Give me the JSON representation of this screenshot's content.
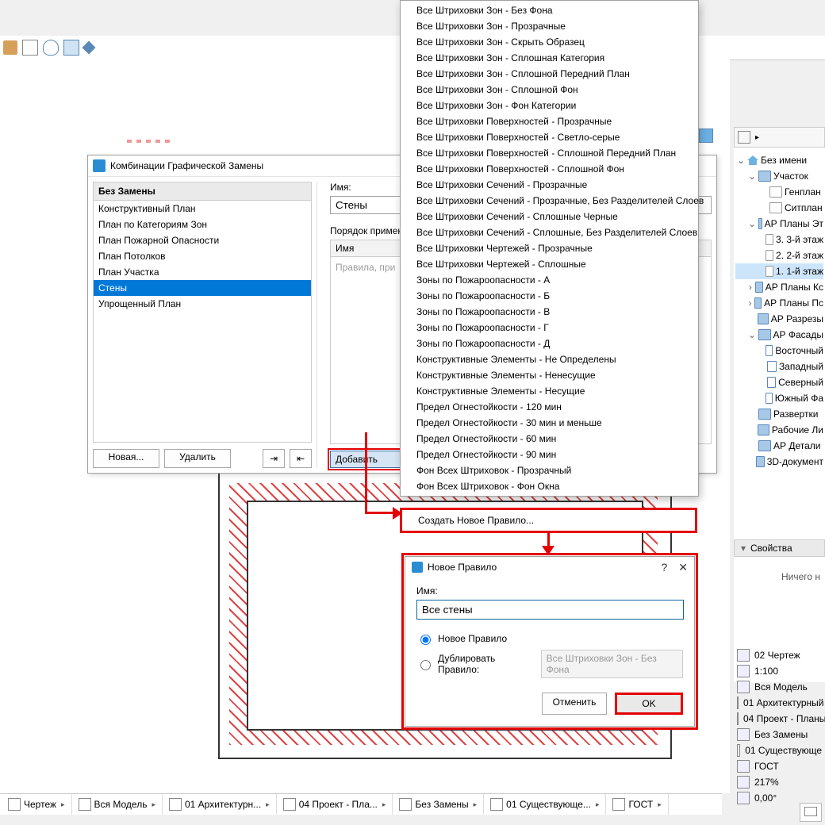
{
  "toolbar": {
    "icons": [
      "layers",
      "note",
      "cloud",
      "book",
      "diamond"
    ]
  },
  "dialog1": {
    "title": "Комбинации Графической Замены",
    "no_override": "Без Замены",
    "combos": [
      "Конструктивный План",
      "План по Категориям Зон",
      "План Пожарной Опасности",
      "План Потолков",
      "План Участка",
      "Стены",
      "Упрощенный План"
    ],
    "selected_index": 5,
    "btn_new": "Новая...",
    "btn_delete": "Удалить",
    "name_label": "Имя:",
    "name_value": "Стены",
    "order_label": "Порядок примен",
    "col_name": "Имя",
    "placeholder_rules": "Правила, при",
    "btn_add": "Добавить"
  },
  "menu_items": [
    "Все Штриховки Зон - Без Фона",
    "Все Штриховки Зон - Прозрачные",
    "Все Штриховки Зон - Скрыть Образец",
    "Все Штриховки Зон - Сплошная Категория",
    "Все Штриховки Зон - Сплошной Передний План",
    "Все Штриховки Зон - Сплошной Фон",
    "Все Штриховки Зон - Фон Категории",
    "Все Штриховки Поверхностей - Прозрачные",
    "Все Штриховки Поверхностей - Светло-серые",
    "Все Штриховки Поверхностей - Сплошной Передний План",
    "Все Штриховки Поверхностей - Сплошной Фон",
    "Все Штриховки Сечений - Прозрачные",
    "Все Штриховки Сечений - Прозрачные, Без Разделителей Слоев",
    "Все Штриховки Сечений - Сплошные Черные",
    "Все Штриховки Сечений - Сплошные, Без Разделителей Слоев",
    "Все Штриховки Чертежей - Прозрачные",
    "Все Штриховки Чертежей - Сплошные",
    "Зоны по Пожароопасности - А",
    "Зоны по Пожароопасности - Б",
    "Зоны по Пожароопасности - В",
    "Зоны по Пожароопасности - Г",
    "Зоны по Пожароопасности - Д",
    "Конструктивные Элементы - Не Определены",
    "Конструктивные Элементы - Ненесущие",
    "Конструктивные Элементы - Несущие",
    "Предел Огнестойкости - 120 мин",
    "Предел Огнестойкости - 30 мин и меньше",
    "Предел Огнестойкости - 60 мин",
    "Предел Огнестойкости - 90 мин",
    "Фон Всех Штриховок - Прозрачный",
    "Фон Всех Штриховок - Фон Окна"
  ],
  "create_rule_item": "Создать Новое Правило...",
  "dialog2": {
    "title": "Новое Правило",
    "help": "?",
    "close": "✕",
    "name_label": "Имя:",
    "name_value": "Все стены",
    "radio_new": "Новое Правило",
    "radio_dup": "Дублировать Правило:",
    "dup_combo": "Все Штриховки Зон - Без Фона",
    "btn_cancel": "Отменить",
    "btn_ok": "OK"
  },
  "navigator": {
    "root": "Без имени",
    "items": [
      {
        "ind": 1,
        "caret": "⌄",
        "icon": "folder",
        "label": "Участок"
      },
      {
        "ind": 2,
        "caret": "",
        "icon": "doc",
        "label": "Генплан"
      },
      {
        "ind": 2,
        "caret": "",
        "icon": "doc",
        "label": "Ситплан"
      },
      {
        "ind": 1,
        "caret": "⌄",
        "icon": "folder",
        "label": "АР Планы Эт"
      },
      {
        "ind": 2,
        "caret": "",
        "icon": "doc",
        "label": "3. 3-й этаж"
      },
      {
        "ind": 2,
        "caret": "",
        "icon": "doc",
        "label": "2. 2-й этаж"
      },
      {
        "ind": 2,
        "caret": "",
        "icon": "doc",
        "label": "1. 1-й этаж",
        "sel": true
      },
      {
        "ind": 1,
        "caret": "›",
        "icon": "folder",
        "label": "АР Планы Кс"
      },
      {
        "ind": 1,
        "caret": "›",
        "icon": "folder",
        "label": "АР Планы Пс"
      },
      {
        "ind": 1,
        "caret": "",
        "icon": "folder",
        "label": "АР Разрезы"
      },
      {
        "ind": 1,
        "caret": "⌄",
        "icon": "folder",
        "label": "АР Фасады"
      },
      {
        "ind": 2,
        "caret": "",
        "icon": "elev",
        "label": "Восточный"
      },
      {
        "ind": 2,
        "caret": "",
        "icon": "elev",
        "label": "Западный"
      },
      {
        "ind": 2,
        "caret": "",
        "icon": "elev",
        "label": "Северный"
      },
      {
        "ind": 2,
        "caret": "",
        "icon": "elev",
        "label": "Южный Фа"
      },
      {
        "ind": 1,
        "caret": "",
        "icon": "folder",
        "label": "Развертки"
      },
      {
        "ind": 1,
        "caret": "",
        "icon": "folder",
        "label": "Рабочие Ли"
      },
      {
        "ind": 1,
        "caret": "",
        "icon": "folder",
        "label": "АР Детали"
      },
      {
        "ind": 1,
        "caret": "",
        "icon": "folder",
        "label": "3D-документ"
      }
    ]
  },
  "props": {
    "title": "Свойства",
    "empty": "Ничего н"
  },
  "quick": [
    {
      "icon": "layers",
      "label": "02 Чертеж"
    },
    {
      "icon": "scale",
      "label": "1:100"
    },
    {
      "icon": "model",
      "label": "Вся Модель"
    },
    {
      "icon": "pen",
      "label": "01 Архитектурный"
    },
    {
      "icon": "view",
      "label": "04 Проект - Планы"
    },
    {
      "icon": "override",
      "label": "Без Замены"
    },
    {
      "icon": "reno",
      "label": "01 Существующе"
    },
    {
      "icon": "dims",
      "label": "ГОСТ"
    },
    {
      "icon": "zoom",
      "label": "217%"
    },
    {
      "icon": "angle",
      "label": "0,00°"
    }
  ],
  "status": [
    {
      "icon": "layers",
      "label": "Чертеж"
    },
    {
      "icon": "model",
      "label": "Вся Модель"
    },
    {
      "icon": "pen",
      "label": "01 Архитектурн..."
    },
    {
      "icon": "view",
      "label": "04 Проект - Пла..."
    },
    {
      "icon": "override",
      "label": "Без Замены"
    },
    {
      "icon": "reno",
      "label": "01 Существующе..."
    },
    {
      "icon": "dims",
      "label": "ГОСТ"
    }
  ]
}
